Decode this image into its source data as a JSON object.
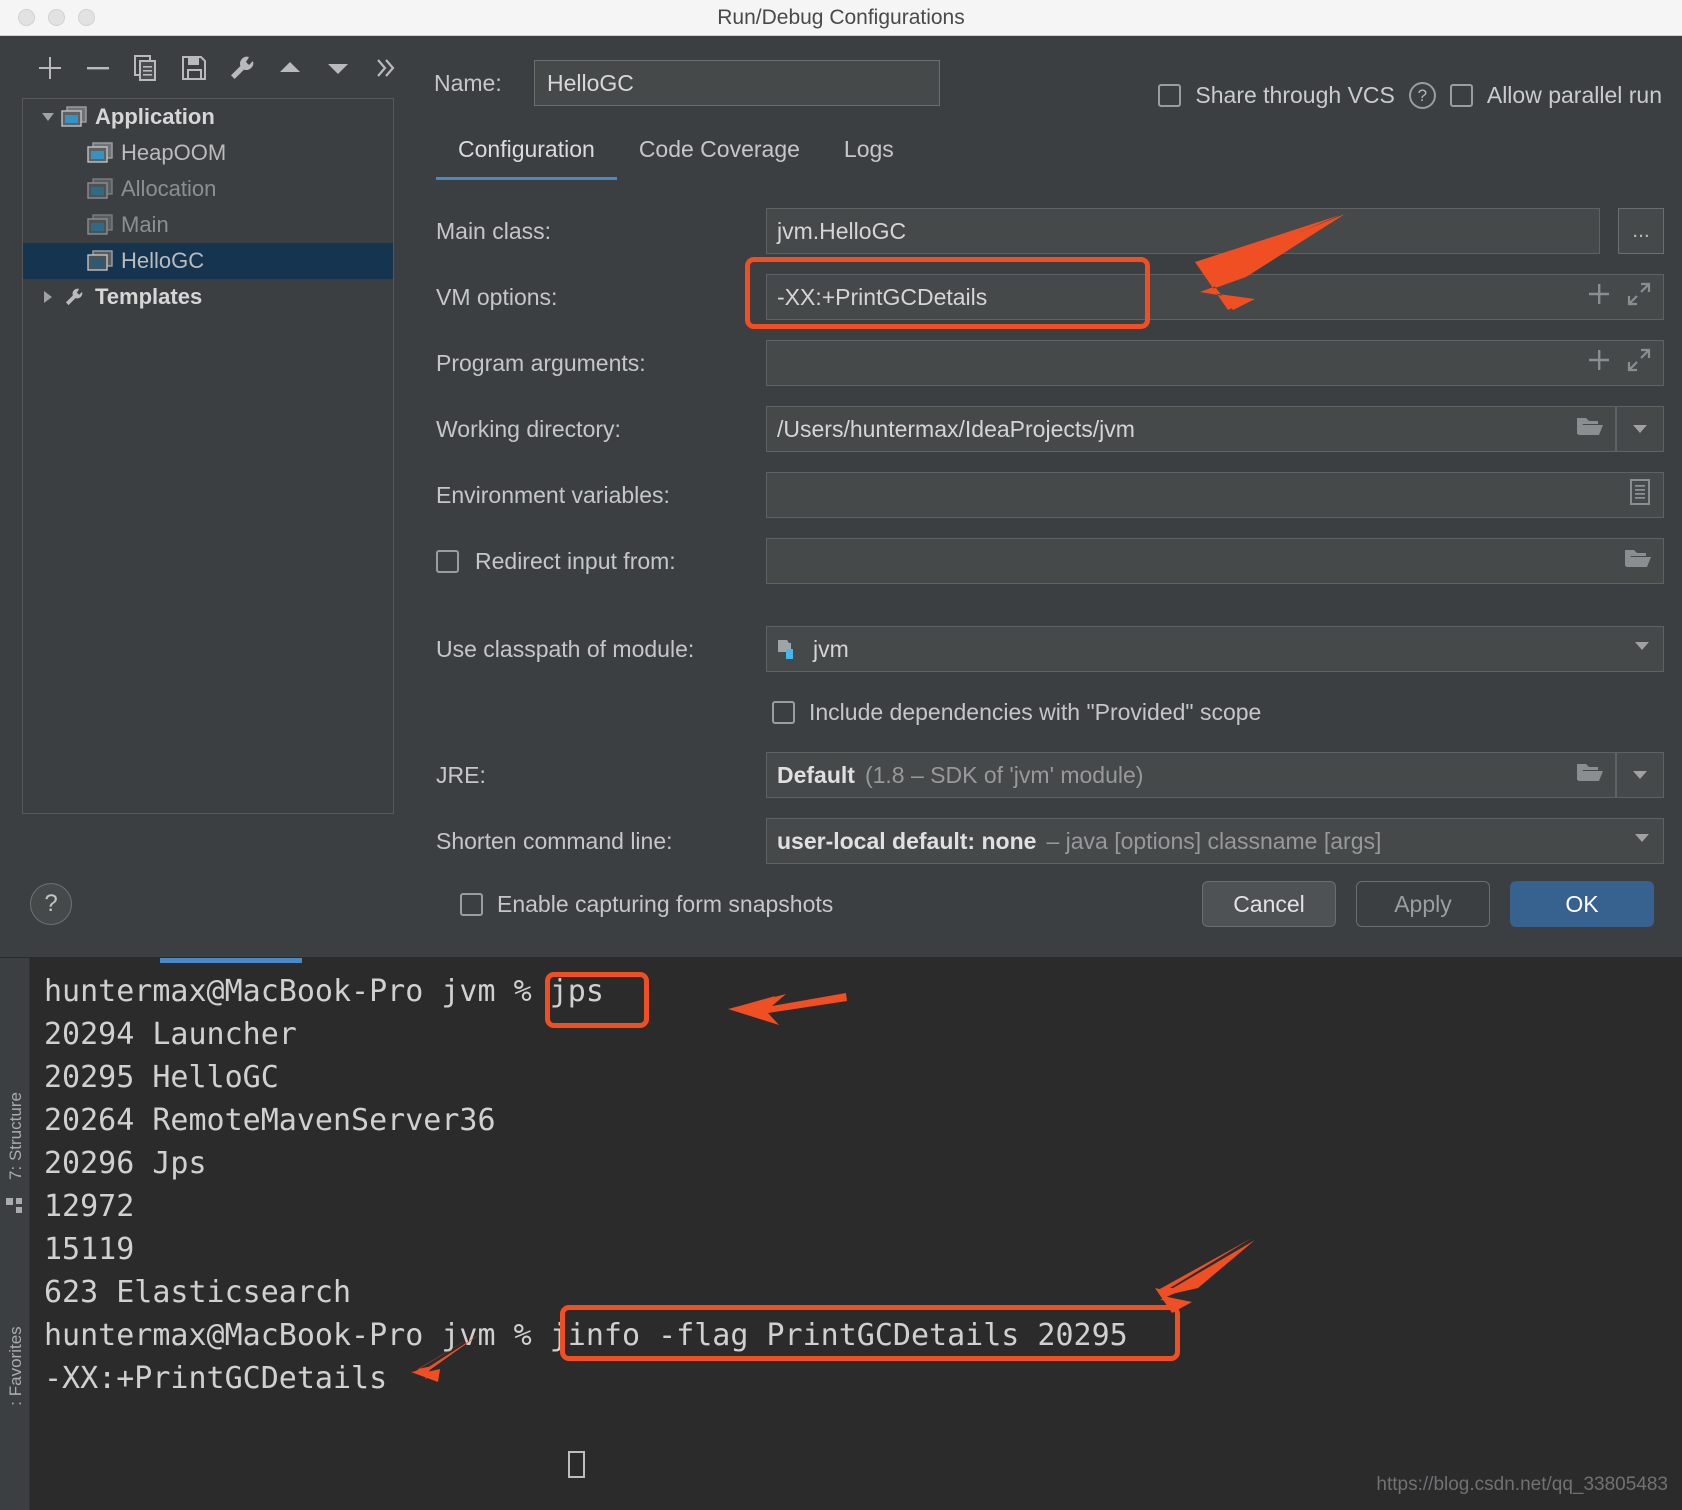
{
  "window": {
    "title": "Run/Debug Configurations",
    "traffic_lights": [
      "close-button",
      "minimize-button",
      "zoom-button"
    ]
  },
  "toolbar": {
    "buttons": [
      {
        "name": "add-configuration-button",
        "icon": "plus-icon"
      },
      {
        "name": "remove-configuration-button",
        "icon": "minus-icon"
      },
      {
        "name": "copy-configuration-button",
        "icon": "copy-icon"
      },
      {
        "name": "save-configuration-button",
        "icon": "save-icon"
      },
      {
        "name": "edit-templates-button",
        "icon": "wrench-icon"
      },
      {
        "name": "move-up-button",
        "icon": "triangle-up-icon"
      },
      {
        "name": "move-down-button",
        "icon": "triangle-down-icon"
      },
      {
        "name": "more-options-button",
        "icon": "chevron-double-right-icon"
      }
    ]
  },
  "tree": {
    "items": [
      {
        "label": "Application",
        "level": 0,
        "bold": true,
        "dim": false,
        "selected": false,
        "twisty": "down",
        "icon": "application-icon"
      },
      {
        "label": "HeapOOM",
        "level": 1,
        "bold": false,
        "dim": false,
        "selected": false,
        "twisty": "none",
        "icon": "run-config-icon"
      },
      {
        "label": "Allocation",
        "level": 1,
        "bold": false,
        "dim": true,
        "selected": false,
        "twisty": "none",
        "icon": "run-config-icon"
      },
      {
        "label": "Main",
        "level": 1,
        "bold": false,
        "dim": true,
        "selected": false,
        "twisty": "none",
        "icon": "run-config-icon"
      },
      {
        "label": "HelloGC",
        "level": 1,
        "bold": false,
        "dim": false,
        "selected": true,
        "twisty": "none",
        "icon": "run-config-icon"
      },
      {
        "label": "Templates",
        "level": 0,
        "bold": true,
        "dim": false,
        "selected": false,
        "twisty": "right",
        "icon": "wrench-icon"
      }
    ]
  },
  "header": {
    "name_label": "Name:",
    "name_value": "HelloGC",
    "share_label": "Share through VCS",
    "help_glyph": "?",
    "parallel_label": "Allow parallel run"
  },
  "tabs": [
    {
      "label": "Configuration",
      "active": true
    },
    {
      "label": "Code Coverage",
      "active": false
    },
    {
      "label": "Logs",
      "active": false
    }
  ],
  "form": {
    "main_class": {
      "label": "Main class:",
      "value": "jvm.HelloGC",
      "browse": "..."
    },
    "vm_options": {
      "label": "VM options:",
      "value": "-XX:+PrintGCDetails",
      "placeholder": ""
    },
    "program_arguments": {
      "label": "Program arguments:",
      "value": ""
    },
    "working_directory": {
      "label": "Working directory:",
      "value": "/Users/huntermax/IdeaProjects/jvm"
    },
    "environment_variables": {
      "label": "Environment variables:",
      "value": ""
    },
    "redirect_input": {
      "label": "Redirect input from:",
      "value": "",
      "checked": false
    },
    "classpath_module": {
      "label": "Use classpath of module:",
      "value": "jvm"
    },
    "include_provided": {
      "label": "Include dependencies with \"Provided\" scope",
      "checked": false
    },
    "jre": {
      "label": "JRE:",
      "value": "Default",
      "value_suffix": "(1.8 – SDK of 'jvm' module)"
    },
    "shorten_command_line": {
      "label": "Shorten command line:",
      "value": "user-local default: none",
      "value_suffix": "– java [options] classname [args]"
    },
    "form_snapshots": {
      "label": "Enable capturing form snapshots",
      "checked": false
    }
  },
  "footer": {
    "help": "?",
    "cancel": "Cancel",
    "apply": "Apply",
    "ok": "OK"
  },
  "terminal": {
    "lines": [
      "huntermax@MacBook-Pro jvm % jps",
      "20294 Launcher",
      "20295 HelloGC",
      "20264 RemoteMavenServer36",
      "20296 Jps",
      "12972",
      "15119",
      "623 Elasticsearch",
      "huntermax@MacBook-Pro jvm % jinfo -flag PrintGCDetails 20295",
      "-XX:+PrintGCDetails"
    ],
    "watermark": "https://blog.csdn.net/qq_33805483"
  },
  "side_tool_windows": [
    {
      "label": "7: Structure"
    },
    {
      "label": ": Favorites"
    }
  ],
  "annotations": {
    "accent_color": "#f04e23",
    "boxes": [
      {
        "name": "vm-options-highlight"
      },
      {
        "name": "jps-command-highlight"
      },
      {
        "name": "jinfo-command-highlight"
      }
    ],
    "arrows": [
      {
        "name": "arrow-to-vm-options"
      },
      {
        "name": "arrow-to-jps"
      },
      {
        "name": "arrow-to-jinfo"
      },
      {
        "name": "arrow-to-printgcdetails-output"
      }
    ]
  }
}
